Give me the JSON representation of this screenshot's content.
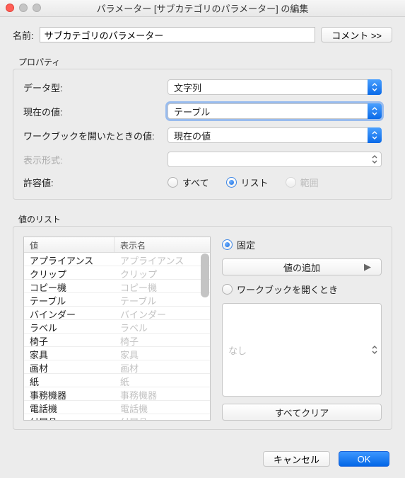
{
  "titlebar": {
    "title": "パラメーター [サブカテゴリのパラメーター] の編集"
  },
  "name": {
    "label": "名前:",
    "value": "サブカテゴリのパラメーター"
  },
  "comment_btn": "コメント >>",
  "properties": {
    "legend": "プロパティ",
    "datatype": {
      "label": "データ型:",
      "value": "文字列"
    },
    "current": {
      "label": "現在の値:",
      "value": "テーブル"
    },
    "onopen": {
      "label": "ワークブックを開いたときの値:",
      "value": "現在の値"
    },
    "display": {
      "label": "表示形式:",
      "value": ""
    },
    "allow": {
      "label": "許容値:",
      "options": {
        "all": "すべて",
        "list": "リスト",
        "range": "範囲"
      },
      "selected": "list"
    }
  },
  "valuelist": {
    "legend": "値のリスト",
    "headers": {
      "value": "値",
      "display": "表示名"
    },
    "rows": [
      {
        "v": "アプライアンス",
        "d": "アプライアンス"
      },
      {
        "v": "クリップ",
        "d": "クリップ"
      },
      {
        "v": "コピー機",
        "d": "コピー機"
      },
      {
        "v": "テーブル",
        "d": "テーブル"
      },
      {
        "v": "バインダー",
        "d": "バインダー"
      },
      {
        "v": "ラベル",
        "d": "ラベル"
      },
      {
        "v": "椅子",
        "d": "椅子"
      },
      {
        "v": "家具",
        "d": "家具"
      },
      {
        "v": "画材",
        "d": "画材"
      },
      {
        "v": "紙",
        "d": "紙"
      },
      {
        "v": "事務機器",
        "d": "事務機器"
      },
      {
        "v": "電話機",
        "d": "電話機"
      },
      {
        "v": "付属品",
        "d": "付属品"
      }
    ],
    "mode": {
      "fixed": "固定",
      "onopen": "ワークブックを開くとき",
      "selected": "fixed"
    },
    "add_btn": "値の追加",
    "refresh_select": "なし",
    "clear_btn": "すべてクリア"
  },
  "footer": {
    "cancel": "キャンセル",
    "ok": "OK"
  }
}
